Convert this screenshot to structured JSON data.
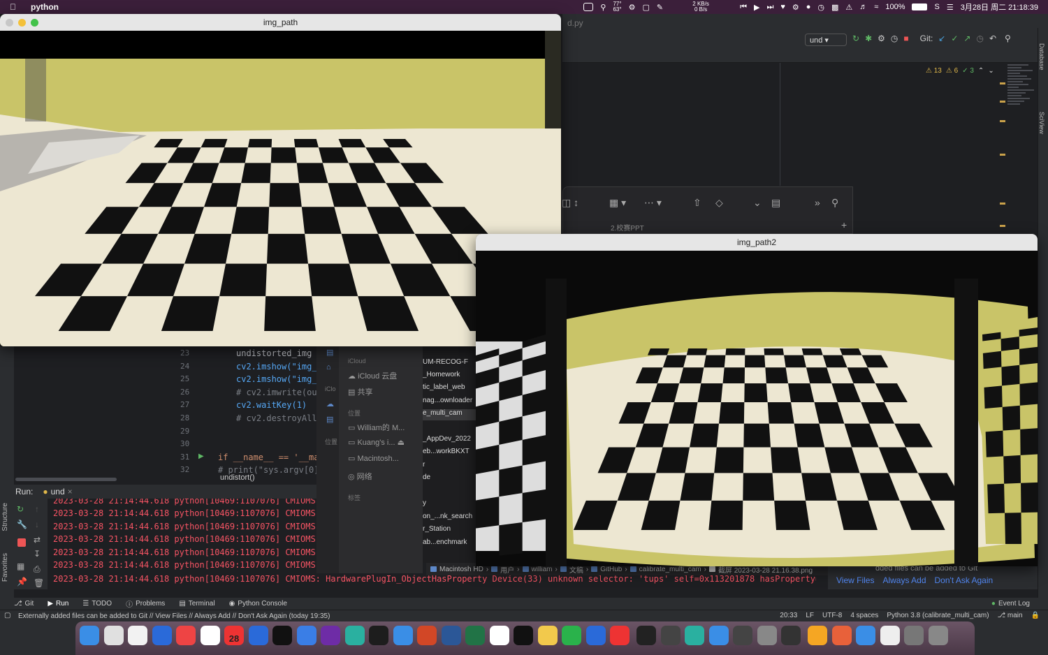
{
  "menubar": {
    "app_name": "python",
    "net_up": "2 KB/s",
    "net_down": "0 B/s",
    "temp_top": "77°",
    "temp_bottom": "63°",
    "battery": "100%",
    "datetime": "3月28日 周二  21:18:39"
  },
  "ide": {
    "file_tab": "d.py",
    "run_config": "und",
    "git_label": "Git:",
    "warnings": "13",
    "weak_warnings": "6",
    "typos": "3",
    "right_tabs": [
      "Database",
      "SciView"
    ],
    "gutter_lines": [
      "23",
      "24",
      "25",
      "26",
      "27",
      "28",
      "29",
      "30",
      "31",
      "32"
    ],
    "code_lines": [
      "undistorted_img = ",
      "cv2.imshow(\"img_p",
      "cv2.imshow(\"img_p",
      "# cv2.imwrite(out",
      "cv2.waitKey(1)",
      "# cv2.destroyAllW",
      "",
      "",
      "if __name__ == '__mai",
      "    # print(\"sys.argv[0]\""
    ],
    "breadcrumb": "undistort()",
    "run_label": "Run:",
    "run_tab": "und",
    "log_lines": [
      "2023-03-28 21:14:44.618 python[10469:1107076] CMIOMS: Hardwar",
      "2023-03-28 21:14:44.618 python[10469:1107076] CMIOMS: Hardwar",
      "2023-03-28 21:14:44.618 python[10469:1107076] CMIOMS: Hardwar",
      "2023-03-28 21:14:44.618 python[10469:1107076] CMIOMS: Hardwar",
      "2023-03-28 21:14:44.618 python[10469:1107076] CMIOMS: Hardwar",
      "2023-03-28 21:14:44.618 python[10469:1107076] CMIOMS: Device "
    ],
    "log_last": "2023-03-28 21:14:44.618 python[10469:1107076] CMIOMS: HardwarePlugIn_ObjectHasProperty Device(33) unknown selector: 'tups' self=0x113201878 hasProperty=0",
    "notif_top": "dded files can be added to Git",
    "notif_links": [
      "View Files",
      "Always Add",
      "Don't Ask Again"
    ],
    "bottom_tabs": [
      "Git",
      "Run",
      "TODO",
      "Problems",
      "Terminal",
      "Python Console"
    ],
    "event_log": "Event Log",
    "status_msg": "Externally added files can be added to Git // View Files // Always Add // Don't Ask Again (today 19:35)",
    "status_right": [
      "20:33",
      "LF",
      "UTF-8",
      "4 spaces",
      "Python 3.8 (calibrate_multi_cam)",
      "main"
    ],
    "left_vtabs": [
      "Structure",
      "Favorites"
    ]
  },
  "finder": {
    "folder_label": "2.校赛PPT",
    "icloud_head": "iCloud",
    "icloud_items": [
      "iCloud 云盘",
      "共享"
    ],
    "locations_head": "位置",
    "locations": [
      "William的 M...",
      "Kuang's i...",
      "Macintosh...",
      "网络"
    ],
    "tags_head": "标签",
    "narrow_labels": [
      "iClo",
      "位置"
    ],
    "files": [
      "UM-RECOG-F",
      "_Homework",
      "tic_label_web",
      "nag...ownloader",
      "e_multi_cam",
      "",
      "_AppDev_2022",
      "eb...workBKXT",
      "r",
      "de",
      "",
      "y",
      "on_...nk_search",
      "r_Station",
      "ab...enchmark"
    ],
    "path": [
      "Macintosh HD",
      "用户",
      "william",
      "文稿",
      "GitHub",
      "calibrate_multi_cam",
      "截屏 2023-03-28 21.16.38.png"
    ]
  },
  "windows": {
    "win1_title": "img_path",
    "win2_title": "img_path2"
  },
  "dock": {
    "calendar_month": "3月",
    "calendar_day": "28"
  }
}
